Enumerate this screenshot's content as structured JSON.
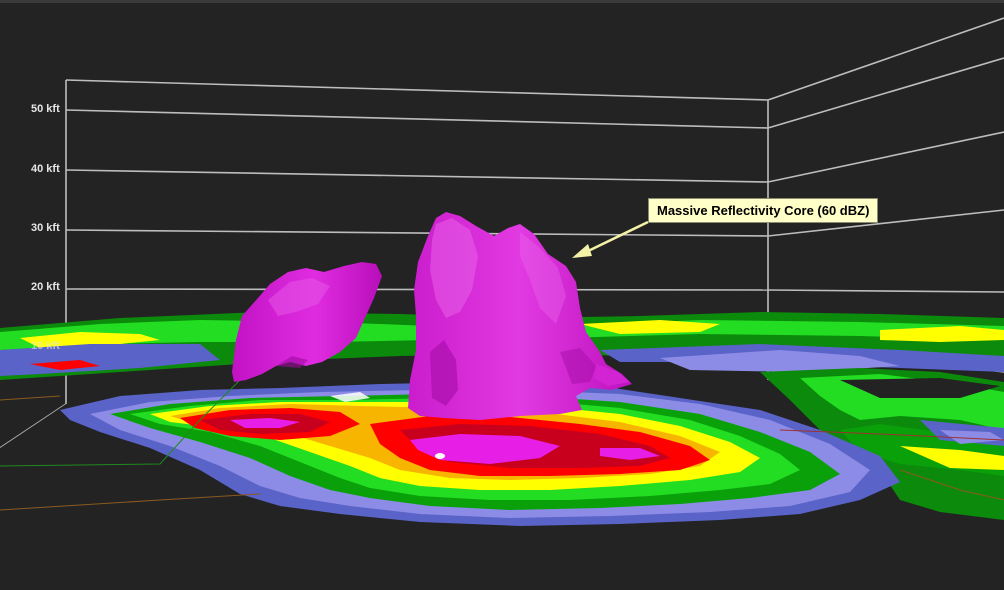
{
  "scene": {
    "altitude_labels": [
      "50 kft",
      "40 kft",
      "30 kft",
      "20 kft",
      "10 kft"
    ],
    "callout": {
      "text": "Massive Reflectivity Core (60 dBZ)"
    },
    "colors": {
      "background": "#232323",
      "grid_lines": "#bdbdbd",
      "core_isosurface": "#d41ad4",
      "callout_fill": "#ffffc8",
      "callout_arrow": "#f4f2a8",
      "reflectivity_scale": [
        "#5a63c8",
        "#8c8ce6",
        "#0aa00a",
        "#22dd22",
        "#ffff00",
        "#f7b500",
        "#ff0000",
        "#c8001e",
        "#e61ee6"
      ]
    }
  }
}
